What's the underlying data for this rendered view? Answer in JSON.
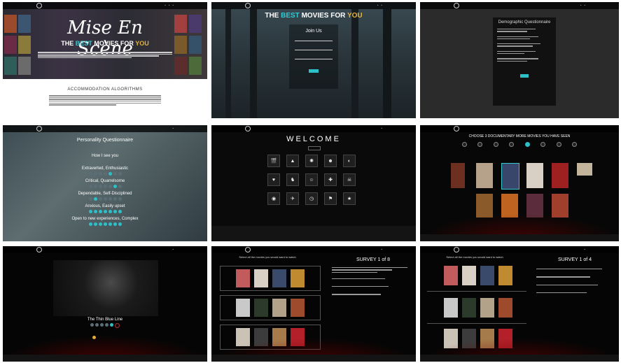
{
  "panel1": {
    "title": "Mise En Scène",
    "tagline": {
      "the": "THE",
      "best": "BEST",
      "movies_for": "MOVIES FOR",
      "you": "YOU"
    },
    "section_title": "ACCOMMODATION ALGORITHMS",
    "colors": {
      "accent": "#37c8cf",
      "gold": "#e3b33b"
    }
  },
  "panel2": {
    "headline": {
      "the": "THE",
      "best": "BEST",
      "movies_for": "MOVIES FOR",
      "you": "YOU"
    },
    "join_title": "Join Us"
  },
  "panel3": {
    "title": "Demographic Questionnaire"
  },
  "panel4": {
    "title": "Personality Questionnaire",
    "lines": [
      {
        "label": "How I see you"
      },
      {
        "label": "Extraverted, Enthusiastic"
      },
      {
        "label": "Critical, Quarrelsome"
      },
      {
        "label": "Dependable, Self-Disciplined"
      },
      {
        "label": "Anxious, Easily upset"
      },
      {
        "label": "Open to new experiences, Complex"
      }
    ],
    "selected": [
      5,
      3,
      1,
      2,
      3,
      5
    ]
  },
  "panel5": {
    "title": "WELCOME",
    "icons": [
      "film-icon",
      "mountain-icon",
      "gear-icon",
      "person-icon",
      "mask-icon",
      "heart-icon",
      "giraffe-icon",
      "face-icon",
      "tool-icon",
      "skull-icon",
      "camera-icon",
      "rocket-icon",
      "clock-icon",
      "flag-icon",
      "star-icon"
    ]
  },
  "panel6": {
    "title": "CHOOSE 3 DOCUMENTARY MORE MOVIES YOU HAVE SEEN"
  },
  "panel7": {
    "caption": "The Thin Blue Line"
  },
  "panel8": {
    "title": "Select all the movies you would want to watch",
    "survey_title": "SURVEY 1 of 8"
  },
  "panel9": {
    "title": "Select all the movies you would want to watch",
    "survey_title": "SURVEY 1 of 4"
  }
}
